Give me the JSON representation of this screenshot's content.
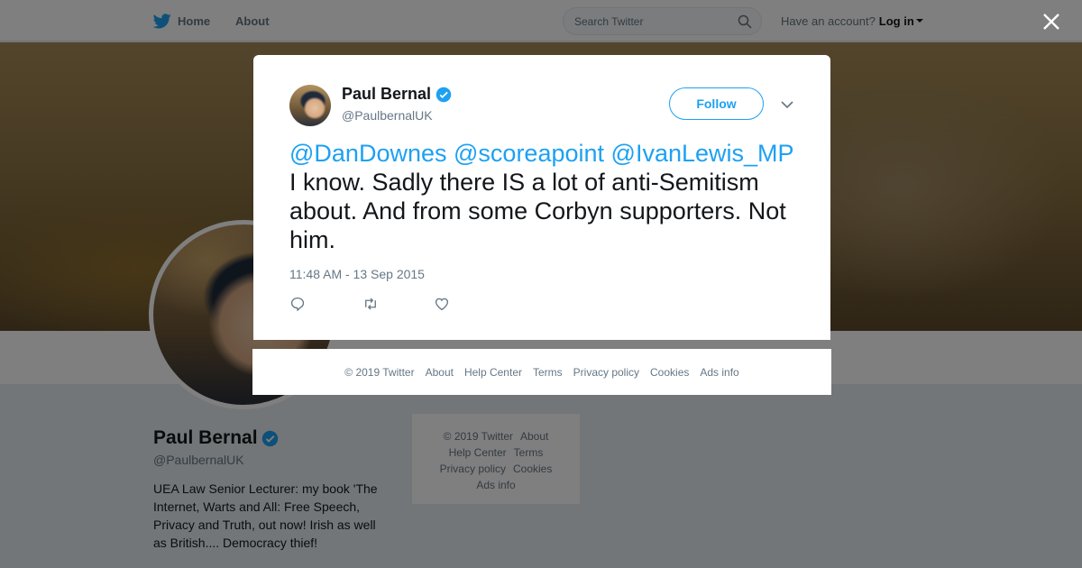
{
  "topbar": {
    "home_label": "Home",
    "about_label": "About",
    "search_placeholder": "Search Twitter",
    "account_prompt": "Have an account?",
    "login_label": "Log in"
  },
  "profile": {
    "name": "Paul Bernal",
    "handle": "@PaulbernalUK",
    "bio": "UEA Law Senior Lecturer: my book 'The Internet, Warts and All: Free Speech, Privacy and Truth, out now! Irish as well as British.... Democracy thief!"
  },
  "side_footer": {
    "lines": [
      [
        "© 2019 Twitter",
        "About"
      ],
      [
        "Help Center",
        "Terms"
      ],
      [
        "Privacy policy",
        "Cookies"
      ],
      [
        "Ads info"
      ]
    ]
  },
  "tweet": {
    "author_name": "Paul Bernal",
    "author_handle": "@PaulbernalUK",
    "follow_label": "Follow",
    "mentions": [
      "@DanDownes",
      "@scoreapoint",
      "@IvanLewis_MP"
    ],
    "body": " I know. Sadly there IS a lot of anti-Semitism about. And from some Corbyn supporters. Not him.",
    "timestamp": "11:48 AM - 13 Sep 2015"
  },
  "modal_footer": {
    "links": [
      "© 2019 Twitter",
      "About",
      "Help Center",
      "Terms",
      "Privacy policy",
      "Cookies",
      "Ads info"
    ]
  },
  "colors": {
    "brand_blue": "#1da1f2",
    "overlay": "rgba(0,0,0,0.5)",
    "text_secondary": "#657786"
  },
  "icons": [
    "twitter-bird-icon",
    "search-icon",
    "verified-badge-icon",
    "chevron-down-icon",
    "reply-icon",
    "retweet-icon",
    "like-icon",
    "close-icon"
  ]
}
